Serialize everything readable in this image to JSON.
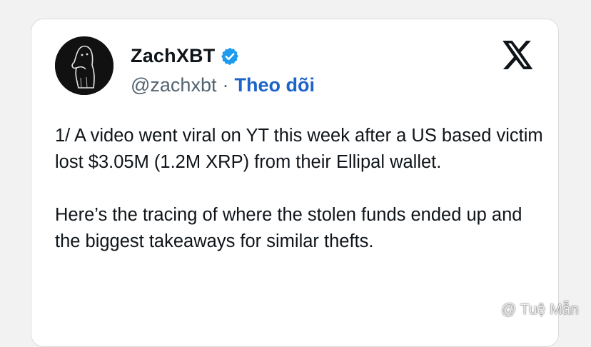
{
  "tweet": {
    "author": {
      "display_name": "ZachXBT",
      "handle": "@zachxbt",
      "separator": "·",
      "follow_label": "Theo dõi",
      "verified": true,
      "verified_color": "#1d9bf0"
    },
    "paragraphs": [
      "1/ A video went viral on YT this week after a US based victim lost $3.05M (1.2M XRP) from their Ellipal wallet.",
      "Here’s the tracing of where the stolen funds ended up and the biggest takeaways for similar thefts."
    ],
    "platform_icon": "x-logo-icon"
  },
  "watermark": {
    "text": "@ Tuệ Mẫn",
    "icon": "binance-diamond-icon"
  },
  "colors": {
    "background": "#f2f2f2",
    "card": "#ffffff",
    "text": "#0f1419",
    "muted": "#536471",
    "link": "#1d64c8"
  }
}
